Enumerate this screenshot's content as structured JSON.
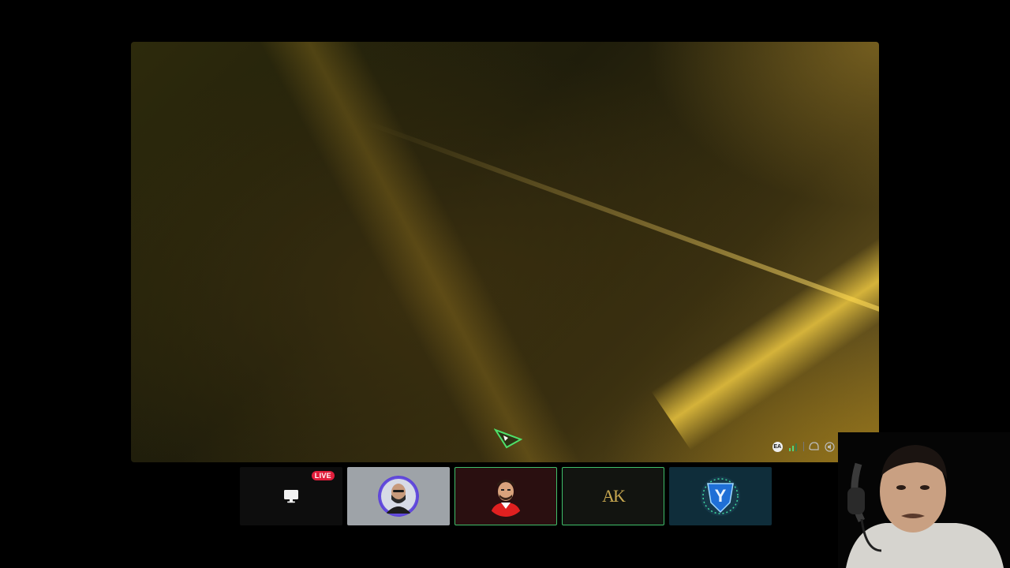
{
  "colors": {
    "background": "#000000",
    "live_badge": "#e01e3c",
    "active_border": "#3fbf6a",
    "gold": "#c8a850"
  },
  "stage": {
    "status_bar": {
      "ea_icon": "ea-icon",
      "signal_icon": "signal-bars-icon",
      "ea_label": "EA",
      "squad_icon": "helmet-icon",
      "sound_icon": "speaker-icon",
      "sound_count": "1",
      "friends_icon": "friends-icon",
      "friends_count": "0"
    }
  },
  "participants": [
    {
      "kind": "screen-share",
      "icon": "monitor-icon",
      "badge": "LIVE"
    },
    {
      "kind": "user",
      "avatar": "bald-man-avatar"
    },
    {
      "kind": "user",
      "avatar": "red-jersey-avatar",
      "speaking": true
    },
    {
      "kind": "user",
      "avatar": "ak-logo-avatar",
      "logo_text": "AK",
      "speaking": true
    },
    {
      "kind": "user",
      "avatar": "y-shield-avatar",
      "logo_text": "Y"
    }
  ],
  "webcam": {
    "label": "streamer-webcam"
  }
}
